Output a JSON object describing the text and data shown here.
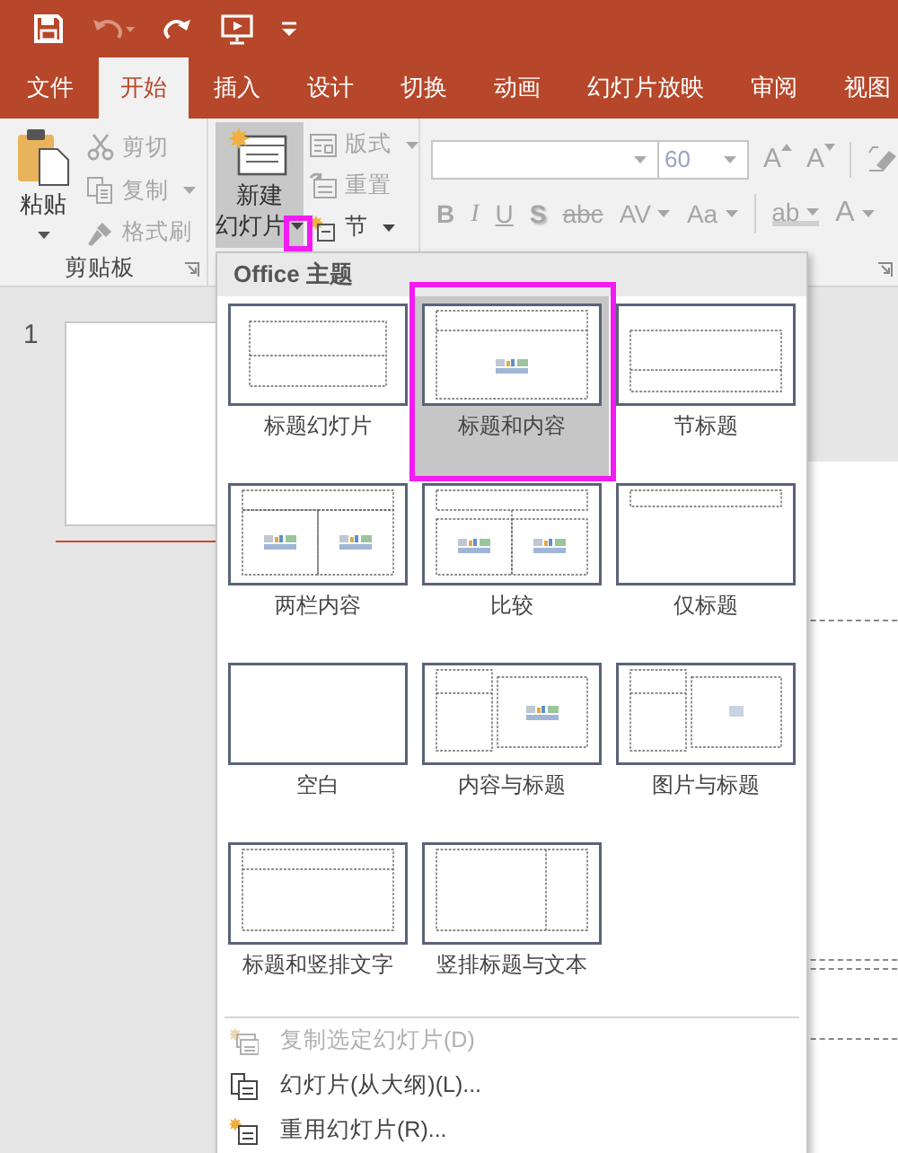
{
  "quick_access": [
    {
      "kind": "save",
      "disabled": false
    },
    {
      "kind": "undo",
      "disabled": true
    },
    {
      "kind": "redo",
      "disabled": false
    },
    {
      "kind": "slideshow",
      "disabled": false
    },
    {
      "kind": "customize",
      "disabled": false
    }
  ],
  "tabs": [
    {
      "label": "文件",
      "selected": false
    },
    {
      "label": "开始",
      "selected": true
    },
    {
      "label": "插入",
      "selected": false
    },
    {
      "label": "设计",
      "selected": false
    },
    {
      "label": "切换",
      "selected": false
    },
    {
      "label": "动画",
      "selected": false
    },
    {
      "label": "幻灯片放映",
      "selected": false
    },
    {
      "label": "审阅",
      "selected": false
    },
    {
      "label": "视图",
      "selected": false
    }
  ],
  "clipboard": {
    "paste": {
      "label": "粘贴"
    },
    "group_label": "剪贴板",
    "commands": [
      {
        "kind": "cut",
        "label": "剪切",
        "disabled": true,
        "dropdown": false
      },
      {
        "kind": "copy",
        "label": "复制",
        "disabled": true,
        "dropdown": true
      },
      {
        "kind": "format_painter",
        "label": "格式刷",
        "disabled": true,
        "dropdown": false
      }
    ]
  },
  "slides": {
    "new_slide": {
      "lines": [
        "新建",
        "幻灯片"
      ],
      "pressed": true
    },
    "commands": [
      {
        "kind": "layout",
        "label": "版式",
        "disabled": true,
        "dropdown": true
      },
      {
        "kind": "reset",
        "label": "重置",
        "disabled": true,
        "dropdown": false
      },
      {
        "kind": "section",
        "label": "节",
        "disabled": false,
        "dropdown": true
      }
    ]
  },
  "font": {
    "disabled": true,
    "font_size": "60",
    "row1": [
      {
        "kind": "grow",
        "glyph": "A"
      },
      {
        "kind": "shrink",
        "glyph": "A"
      },
      {
        "kind": "clear"
      }
    ],
    "row2": [
      {
        "kind": "bold",
        "glyph": "B",
        "dropdown": false
      },
      {
        "kind": "italic",
        "glyph": "I",
        "dropdown": false
      },
      {
        "kind": "underline",
        "glyph": "U",
        "dropdown": false
      },
      {
        "kind": "shadow",
        "glyph": "S",
        "dropdown": false
      },
      {
        "kind": "strike",
        "glyph": "abc",
        "dropdown": false
      },
      {
        "kind": "spacing",
        "glyph": "AV",
        "dropdown": true
      },
      {
        "kind": "case",
        "glyph": "Aa",
        "dropdown": true
      },
      {
        "kind": "highlight",
        "glyph": "ab",
        "dropdown": true
      },
      {
        "kind": "color",
        "glyph": "A",
        "dropdown": true
      }
    ]
  },
  "slide_pane": {
    "number": "1"
  },
  "layout_menu": {
    "header": "Office 主题",
    "layouts": [
      {
        "kind": "title_slide",
        "label": "标题幻灯片",
        "selected": false
      },
      {
        "kind": "title_content",
        "label": "标题和内容",
        "selected": true
      },
      {
        "kind": "section_header",
        "label": "节标题",
        "selected": false
      },
      {
        "kind": "two_content",
        "label": "两栏内容",
        "selected": false
      },
      {
        "kind": "comparison",
        "label": "比较",
        "selected": false
      },
      {
        "kind": "title_only",
        "label": "仅标题",
        "selected": false
      },
      {
        "kind": "blank",
        "label": "空白",
        "selected": false
      },
      {
        "kind": "content_caption",
        "label": "内容与标题",
        "selected": false
      },
      {
        "kind": "picture_caption",
        "label": "图片与标题",
        "selected": false
      },
      {
        "kind": "vertical_text",
        "label": "标题和竖排文字",
        "selected": false
      },
      {
        "kind": "vertical_title",
        "label": "竖排标题与文本",
        "selected": false
      }
    ],
    "commands": [
      {
        "kind": "duplicate",
        "label": "复制选定幻灯片(D)",
        "disabled": true
      },
      {
        "kind": "outline",
        "label": "幻灯片(从大纲)(L)...",
        "disabled": false
      },
      {
        "kind": "reuse",
        "label": "重用幻灯片(R)...",
        "disabled": false
      }
    ]
  }
}
